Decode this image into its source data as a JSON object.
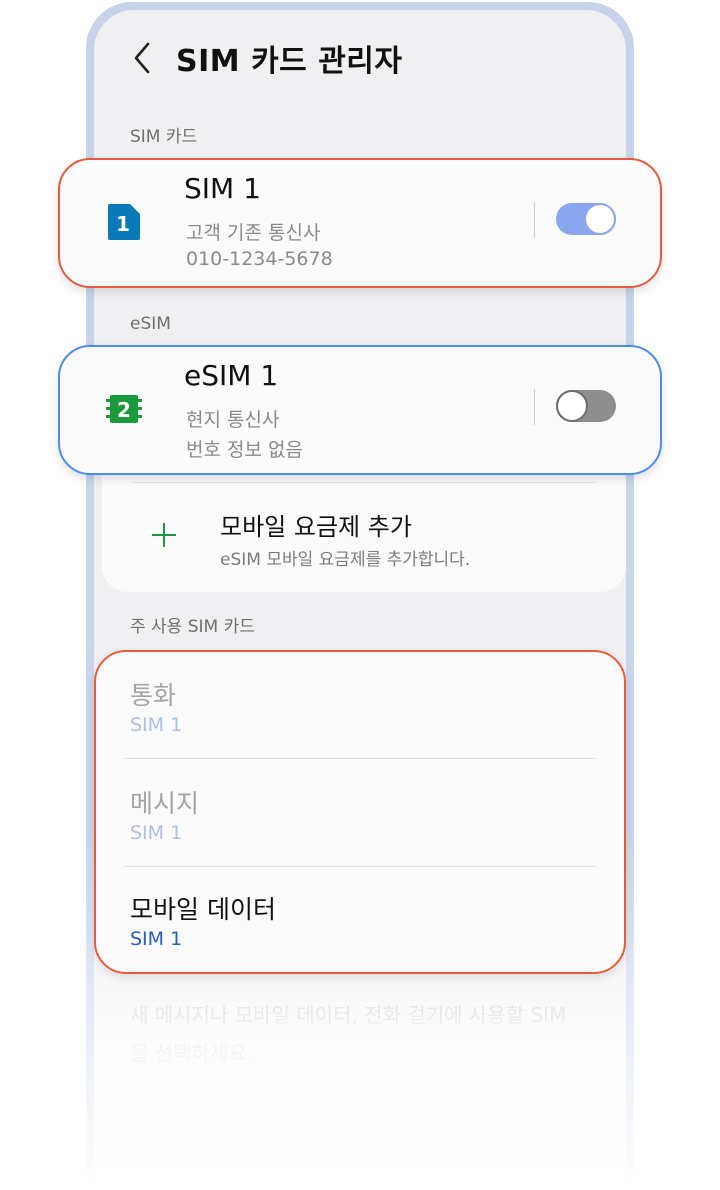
{
  "header": {
    "title": "SIM 카드 관리자"
  },
  "sections": {
    "sim_cards": "SIM 카드",
    "esim": "eSIM",
    "primary": "주 사용 SIM 카드"
  },
  "sim1": {
    "badge": "1",
    "title": "SIM 1",
    "carrier": "고객 기존 통신사",
    "number": "010-1234-5678",
    "enabled": true,
    "badge_color": "#0a79b8"
  },
  "esim1": {
    "badge": "2",
    "title": "eSIM 1",
    "carrier": "현지 통신사",
    "number": "번호 정보 없음",
    "enabled": false,
    "badge_color": "#1a9a3a"
  },
  "add_plan": {
    "title": "모바일 요금제 추가",
    "subtitle": "eSIM 모바일 요금제를 추가합니다.",
    "icon_color": "#1a9a3a"
  },
  "primary_sim": {
    "items": [
      {
        "label": "통화",
        "value": "SIM 1"
      },
      {
        "label": "메시지",
        "value": "SIM 1"
      },
      {
        "label": "모바일 데이터",
        "value": "SIM 1"
      }
    ]
  },
  "footnote": "새 메시지나 모바일 데이터, 전화 걸기에 사용할 SIM을 선택하세요.",
  "colors": {
    "highlight_orange": "#e55b3c",
    "highlight_blue": "#4b8ef0",
    "toggle_on": "#8aa6ef",
    "value_blue": "#2a5ac8"
  }
}
